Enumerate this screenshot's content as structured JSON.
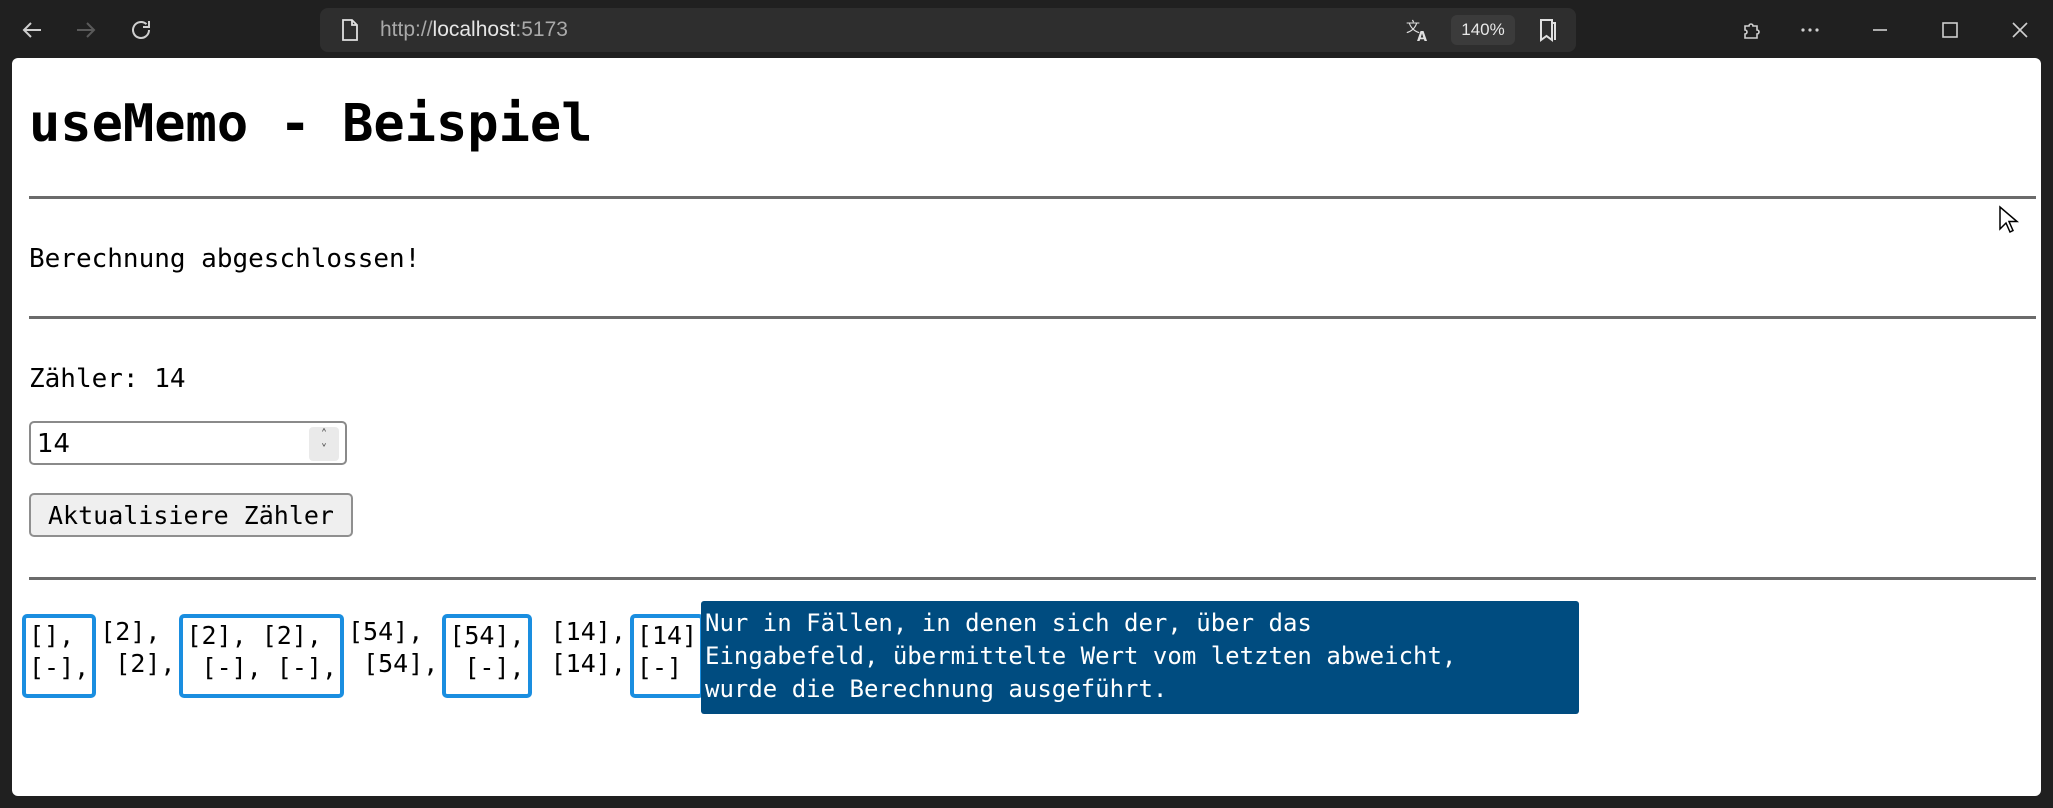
{
  "browser": {
    "url_prefix": "http://",
    "url_host": "localhost",
    "url_port": ":5173",
    "zoom": "140%",
    "icons": {
      "back": "arrow-left-icon",
      "forward": "arrow-right-icon",
      "reload": "reload-icon",
      "page": "page-info-icon",
      "translate": "translate-icon",
      "favorites": "favorites-icon",
      "extensions": "puzzle-icon",
      "more": "more-icon",
      "minimize": "minimize-icon",
      "maximize": "maximize-icon",
      "close": "close-icon"
    }
  },
  "page": {
    "title": "useMemo - Beispiel",
    "status": "Berechnung abgeschlossen!",
    "counter_label": "Zähler: 14",
    "input_value": "14",
    "update_button": "Aktualisiere Zähler",
    "log": [
      {
        "top": "[],",
        "bottom": "[-],",
        "highlighted": true
      },
      {
        "top": "[2],",
        "bottom": " [2],",
        "highlighted": false
      },
      {
        "top": "[2], [2],",
        "bottom": " [-], [-],",
        "highlighted": true
      },
      {
        "top": "[54],",
        "bottom": " [54],",
        "highlighted": false
      },
      {
        "top": "[54],",
        "bottom": " [-],",
        "highlighted": true
      },
      {
        "top": " [14],",
        "bottom": " [14],",
        "highlighted": false
      },
      {
        "top": "[14]",
        "bottom": "[-]",
        "highlighted": true
      }
    ],
    "info": "Nur in Fällen, in denen sich der, über das\nEingabefeld, übermittelte Wert vom letzten abweicht,\nwurde die Berechnung ausgeführt."
  },
  "colors": {
    "highlight_border": "#1a8ee0",
    "info_background": "#004c80"
  }
}
